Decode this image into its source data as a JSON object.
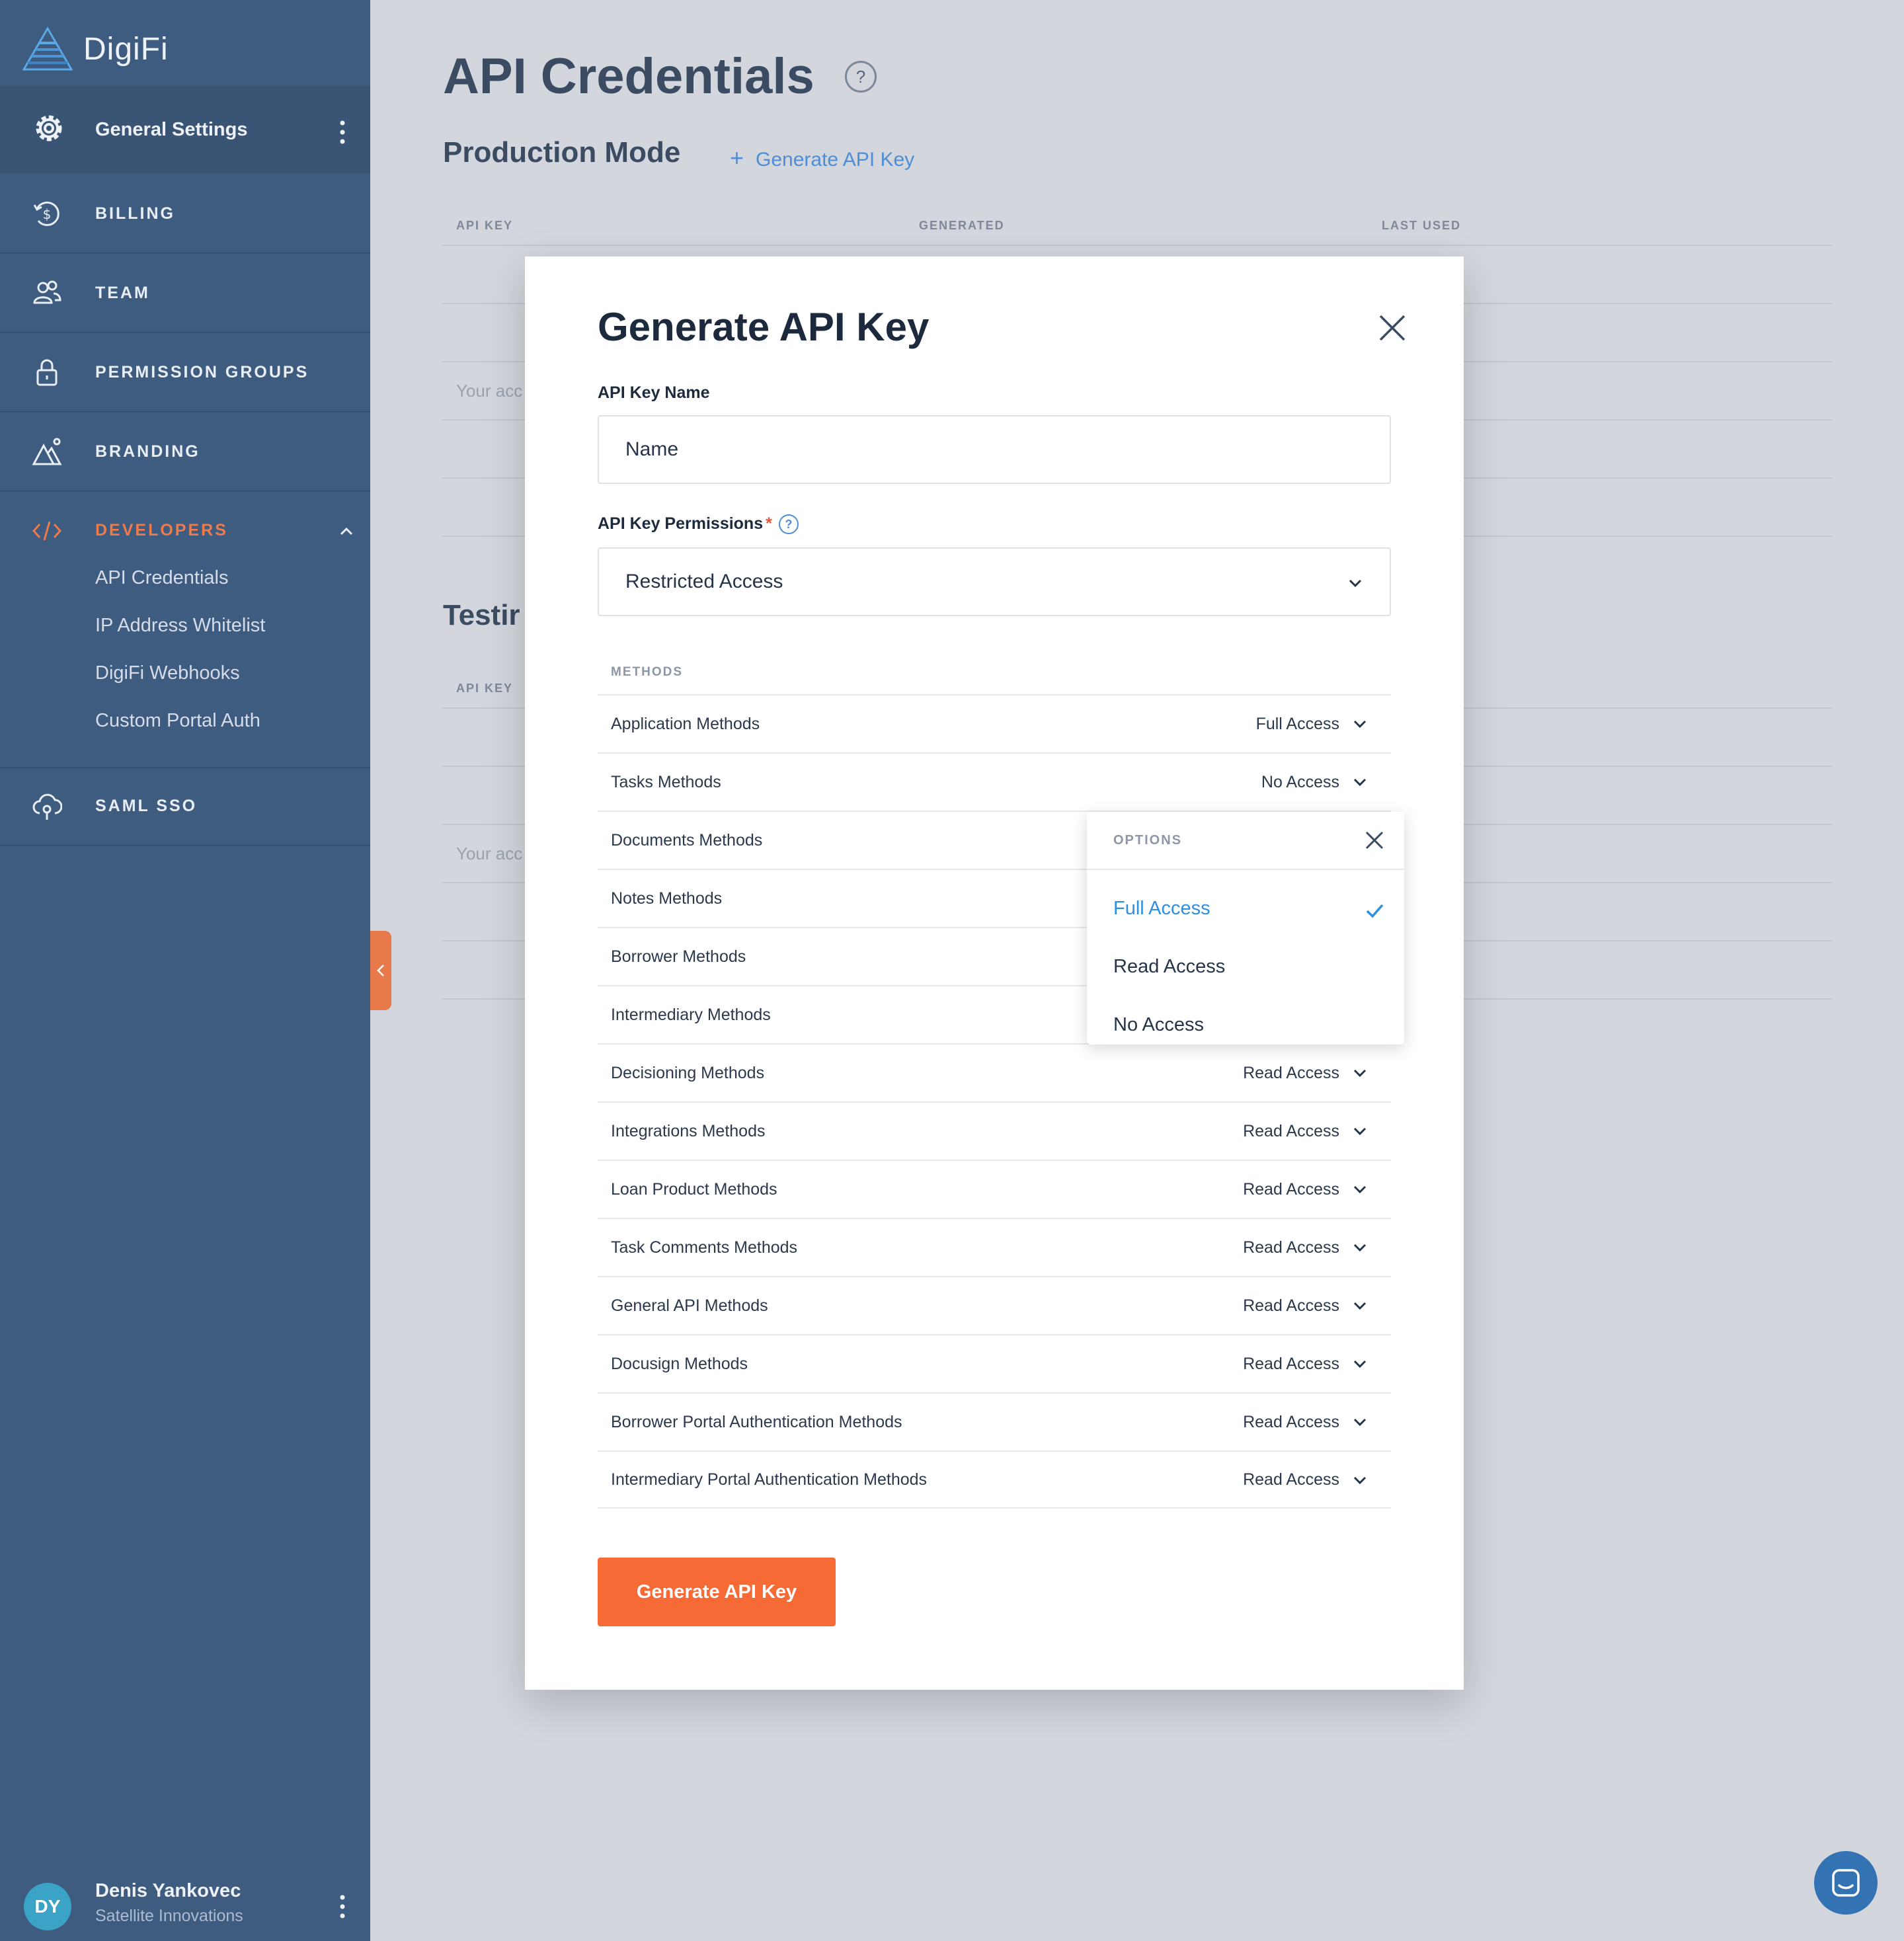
{
  "brand": {
    "name": "DigiFi"
  },
  "sidebar": {
    "header": {
      "label": "General Settings"
    },
    "items": [
      {
        "label": "BILLING"
      },
      {
        "label": "TEAM"
      },
      {
        "label": "PERMISSION GROUPS"
      },
      {
        "label": "BRANDING"
      }
    ],
    "developers": {
      "label": "DEVELOPERS",
      "subitems": [
        "API Credentials",
        "IP Address Whitelist",
        "DigiFi Webhooks",
        "Custom Portal Auth"
      ]
    },
    "saml": {
      "label": "SAML SSO"
    },
    "user": {
      "initials": "DY",
      "name": "Denis Yankovec",
      "org": "Satellite Innovations"
    }
  },
  "page": {
    "title": "API Credentials",
    "help": "?",
    "production": {
      "title": "Production Mode",
      "generate_link": "Generate API Key",
      "plus": "+"
    },
    "table_headers": [
      "API KEY",
      "GENERATED",
      "LAST USED"
    ],
    "hint_fragment": "Your acc",
    "testing": {
      "title_fragment": "Testir",
      "header": "API KEY",
      "hint_fragment": "Your acc"
    }
  },
  "modal": {
    "title": "Generate API Key",
    "name_label": "API Key Name",
    "name_placeholder": "Name",
    "perm_label": "API Key Permissions",
    "required_mark": "*",
    "perm_help": "?",
    "perm_value": "Restricted Access",
    "methods_header": "METHODS",
    "methods": [
      {
        "name": "Application Methods",
        "value": "Full Access"
      },
      {
        "name": "Tasks Methods",
        "value": "No Access"
      },
      {
        "name": "Documents Methods",
        "value": ""
      },
      {
        "name": "Notes Methods",
        "value": ""
      },
      {
        "name": "Borrower Methods",
        "value": ""
      },
      {
        "name": "Intermediary Methods",
        "value": ""
      },
      {
        "name": "Decisioning Methods",
        "value": "Read Access"
      },
      {
        "name": "Integrations Methods",
        "value": "Read Access"
      },
      {
        "name": "Loan Product Methods",
        "value": "Read Access"
      },
      {
        "name": "Task Comments Methods",
        "value": "Read Access"
      },
      {
        "name": "General API Methods",
        "value": "Read Access"
      },
      {
        "name": "Docusign Methods",
        "value": "Read Access"
      },
      {
        "name": "Borrower Portal Authentication Methods",
        "value": "Read Access"
      },
      {
        "name": "Intermediary Portal Authentication Methods",
        "value": "Read Access"
      }
    ],
    "submit_label": "Generate API Key"
  },
  "options_popup": {
    "header": "OPTIONS",
    "options": [
      "Full Access",
      "Read Access",
      "No Access"
    ],
    "selected": "Full Access"
  },
  "colors": {
    "sidebar": "#3e5b80",
    "accent_orange": "#f66a35",
    "link_blue": "#4d8ed6",
    "selected_blue": "#2e8ee0"
  }
}
